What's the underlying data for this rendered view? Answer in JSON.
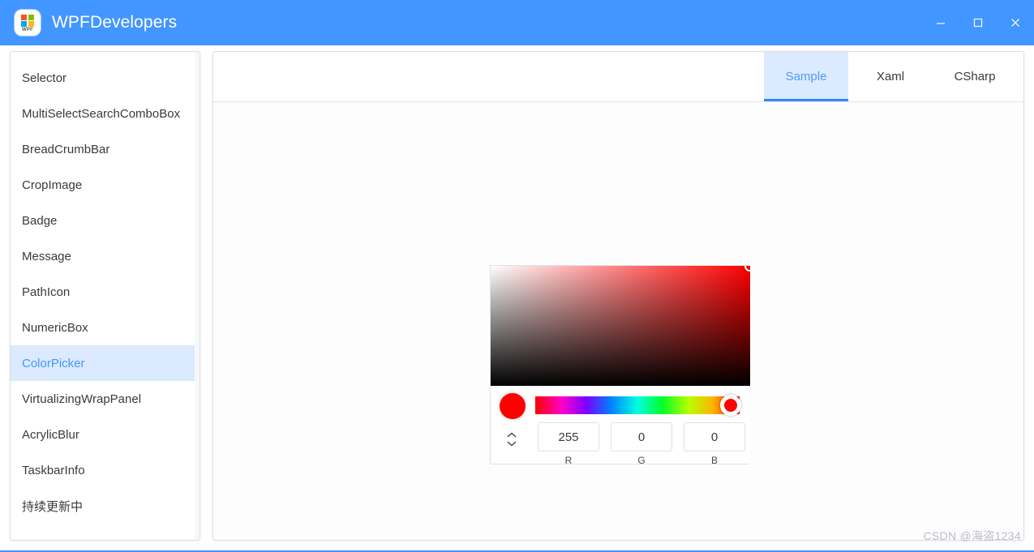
{
  "window": {
    "title": "WPFDevelopers",
    "titlebar_color": "#4296ff",
    "logo": {
      "text": "WPF",
      "tile_colors": [
        "#f35325",
        "#81bc06",
        "#05a6f0",
        "#ffba08"
      ]
    },
    "controls": [
      {
        "name": "minimize",
        "glyph": "minimize-icon"
      },
      {
        "name": "maximize",
        "glyph": "maximize-icon"
      },
      {
        "name": "close",
        "glyph": "close-icon"
      }
    ]
  },
  "sidebar": {
    "items": [
      {
        "label": "Selector",
        "selected": false
      },
      {
        "label": "MultiSelectSearchComboBox",
        "selected": false
      },
      {
        "label": "BreadCrumbBar",
        "selected": false
      },
      {
        "label": "CropImage",
        "selected": false
      },
      {
        "label": "Badge",
        "selected": false
      },
      {
        "label": "Message",
        "selected": false
      },
      {
        "label": "PathIcon",
        "selected": false
      },
      {
        "label": "NumericBox",
        "selected": false
      },
      {
        "label": "ColorPicker",
        "selected": true
      },
      {
        "label": "VirtualizingWrapPanel",
        "selected": false
      },
      {
        "label": "AcrylicBlur",
        "selected": false
      },
      {
        "label": "TaskbarInfo",
        "selected": false
      },
      {
        "label": "持续更新中",
        "selected": false
      }
    ],
    "selected_label": "ColorPicker",
    "accent_color": "#2f86f6",
    "selected_bg": "#dbeafe"
  },
  "main": {
    "tabs": [
      {
        "label": "Sample",
        "active": true
      },
      {
        "label": "Xaml",
        "active": false
      },
      {
        "label": "CSharp",
        "active": false
      }
    ],
    "active_tab": "Sample"
  },
  "color_picker": {
    "selected_color_hex": "#ff0000",
    "hue_thumb_color": "#ff0000",
    "channels": [
      {
        "label": "R",
        "value": "255"
      },
      {
        "label": "G",
        "value": "0"
      },
      {
        "label": "B",
        "value": "0"
      }
    ],
    "spinner": {
      "up": "chevron-up-icon",
      "down": "chevron-down-icon"
    }
  },
  "watermark": {
    "text": "CSDN @海盗1234"
  }
}
